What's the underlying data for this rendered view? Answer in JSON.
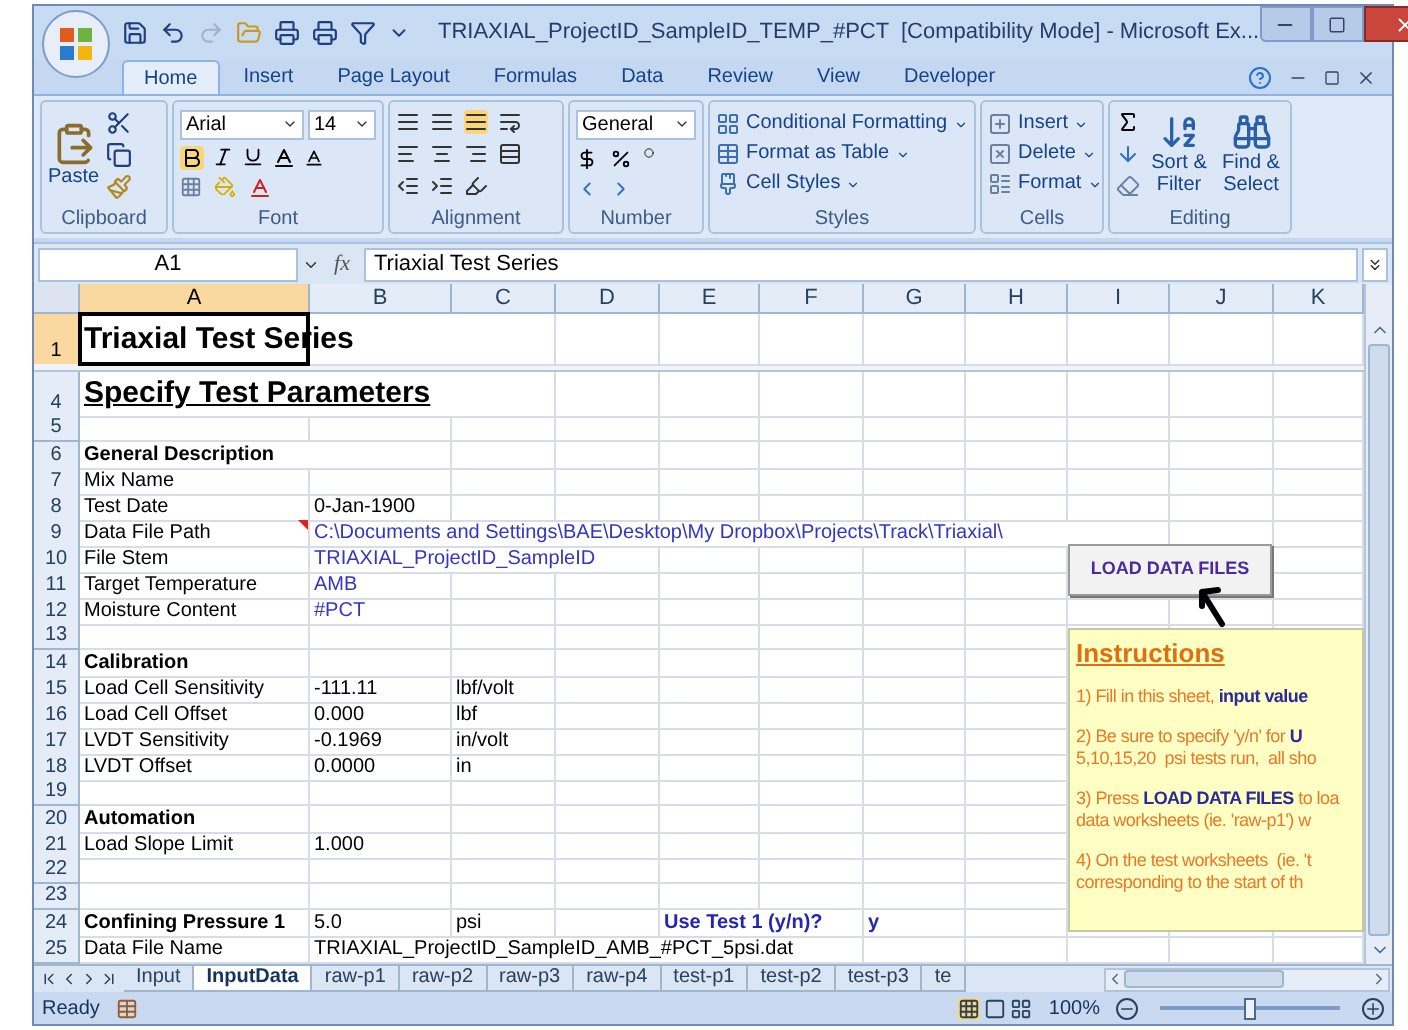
{
  "window": {
    "title": "TRIAXIAL_ProjectID_SampleID_TEMP_#PCT  [Compatibility Mode] - Microsoft Ex..."
  },
  "ribbon_tabs": [
    {
      "label": "Home",
      "selected": true
    },
    {
      "label": "Insert",
      "selected": false
    },
    {
      "label": "Page Layout",
      "selected": false
    },
    {
      "label": "Formulas",
      "selected": false
    },
    {
      "label": "Data",
      "selected": false
    },
    {
      "label": "Review",
      "selected": false
    },
    {
      "label": "View",
      "selected": false
    },
    {
      "label": "Developer",
      "selected": false
    }
  ],
  "ribbon": {
    "clipboard": {
      "paste": "Paste",
      "label": "Clipboard"
    },
    "font": {
      "name": "Arial",
      "size": "14",
      "label": "Font"
    },
    "alignment": {
      "label": "Alignment"
    },
    "number": {
      "format": "General",
      "label": "Number"
    },
    "styles": {
      "items": [
        "Conditional Formatting",
        "Format as Table",
        "Cell Styles"
      ],
      "label": "Styles"
    },
    "cells": {
      "items": [
        "Insert",
        "Delete",
        "Format"
      ],
      "label": "Cells"
    },
    "editing": {
      "items": [
        "Sort & Filter",
        "Find & Select"
      ],
      "label": "Editing"
    }
  },
  "formula_bar": {
    "name_box": "A1",
    "function_label": "fx",
    "formula": "Triaxial Test Series"
  },
  "columns": [
    {
      "label": "A",
      "selected": true
    },
    {
      "label": "B",
      "selected": false
    },
    {
      "label": "C",
      "selected": false
    },
    {
      "label": "D",
      "selected": false
    },
    {
      "label": "E",
      "selected": false
    },
    {
      "label": "F",
      "selected": false
    },
    {
      "label": "G",
      "selected": false
    },
    {
      "label": "H",
      "selected": false
    },
    {
      "label": "I",
      "selected": false
    },
    {
      "label": "J",
      "selected": false
    },
    {
      "label": "K",
      "selected": false
    }
  ],
  "rows": [
    {
      "kind": "title",
      "number": "1",
      "selected": true,
      "cells": {
        "A": {
          "kind": "title",
          "text": "Triaxial Test Series"
        }
      }
    },
    {
      "kind": "hidden"
    },
    {
      "kind": "heading",
      "number": "4",
      "selected": false,
      "cells": {
        "A": {
          "kind": "heading",
          "text": "Specify Test Parameters"
        }
      }
    },
    {
      "kind": "normal",
      "number": "5",
      "selected": false
    },
    {
      "kind": "normal",
      "number": "6",
      "selected": false,
      "cells": {
        "A": {
          "kind": "section",
          "text": "General Description"
        }
      }
    },
    {
      "kind": "normal",
      "number": "7",
      "selected": false,
      "cells": {
        "A": {
          "kind": "text",
          "text": "Mix Name"
        }
      }
    },
    {
      "kind": "normal",
      "number": "8",
      "selected": false,
      "cells": {
        "A": {
          "kind": "text",
          "text": "Test Date"
        },
        "B": {
          "kind": "text",
          "text": "0-Jan-1900"
        }
      }
    },
    {
      "kind": "normal",
      "number": "9",
      "selected": false,
      "cells": {
        "A": {
          "kind": "text",
          "text": "Data File Path",
          "comment": true
        },
        "B": {
          "kind": "link",
          "text": "C:\\Documents and Settings\\BAE\\Desktop\\My Dropbox\\Projects\\Track\\Triaxial\\"
        }
      }
    },
    {
      "kind": "normal",
      "number": "10",
      "selected": false,
      "cells": {
        "A": {
          "kind": "text",
          "text": "File Stem"
        },
        "B": {
          "kind": "link",
          "text": "TRIAXIAL_ProjectID_SampleID"
        }
      }
    },
    {
      "kind": "normal",
      "number": "11",
      "selected": false,
      "cells": {
        "A": {
          "kind": "text",
          "text": "Target Temperature"
        },
        "B": {
          "kind": "link",
          "text": "AMB"
        }
      }
    },
    {
      "kind": "normal",
      "number": "12",
      "selected": false,
      "cells": {
        "A": {
          "kind": "text",
          "text": "Moisture Content"
        },
        "B": {
          "kind": "link",
          "text": "#PCT"
        }
      }
    },
    {
      "kind": "normal",
      "number": "13",
      "selected": false
    },
    {
      "kind": "normal",
      "number": "14",
      "selected": false,
      "cells": {
        "A": {
          "kind": "section",
          "text": "Calibration"
        }
      }
    },
    {
      "kind": "normal",
      "number": "15",
      "selected": false,
      "cells": {
        "A": {
          "kind": "text",
          "text": "Load Cell Sensitivity"
        },
        "B": {
          "kind": "text",
          "text": "-111.11"
        },
        "C": {
          "kind": "text",
          "text": "lbf/volt"
        }
      }
    },
    {
      "kind": "normal",
      "number": "16",
      "selected": false,
      "cells": {
        "A": {
          "kind": "text",
          "text": "Load Cell Offset"
        },
        "B": {
          "kind": "text",
          "text": "0.000"
        },
        "C": {
          "kind": "text",
          "text": "lbf"
        }
      }
    },
    {
      "kind": "normal",
      "number": "17",
      "selected": false,
      "cells": {
        "A": {
          "kind": "text",
          "text": "LVDT Sensitivity"
        },
        "B": {
          "kind": "text",
          "text": "-0.1969"
        },
        "C": {
          "kind": "text",
          "text": "in/volt"
        }
      }
    },
    {
      "kind": "normal",
      "number": "18",
      "selected": false,
      "cells": {
        "A": {
          "kind": "text",
          "text": "LVDT Offset"
        },
        "B": {
          "kind": "text",
          "text": "0.0000"
        },
        "C": {
          "kind": "text",
          "text": "in"
        }
      }
    },
    {
      "kind": "normal",
      "number": "19",
      "selected": false
    },
    {
      "kind": "normal",
      "number": "20",
      "selected": false,
      "cells": {
        "A": {
          "kind": "section",
          "text": "Automation"
        }
      }
    },
    {
      "kind": "normal",
      "number": "21",
      "selected": false,
      "cells": {
        "A": {
          "kind": "text",
          "text": "Load Slope Limit"
        },
        "B": {
          "kind": "text",
          "text": "1.000"
        }
      }
    },
    {
      "kind": "normal",
      "number": "22",
      "selected": false
    },
    {
      "kind": "normal",
      "number": "23",
      "selected": false
    },
    {
      "kind": "normal",
      "number": "24",
      "selected": false,
      "cells": {
        "A": {
          "kind": "section",
          "text": "Confining Pressure 1"
        },
        "B": {
          "kind": "text",
          "text": "5.0"
        },
        "C": {
          "kind": "text",
          "text": "psi"
        },
        "E": {
          "kind": "prompt",
          "text": "Use Test 1 (y/n)?"
        },
        "G": {
          "kind": "prompt",
          "text": "y"
        }
      }
    },
    {
      "kind": "normal",
      "number": "25",
      "selected": false,
      "cells": {
        "A": {
          "kind": "text",
          "text": "Data File Name"
        },
        "B": {
          "kind": "text",
          "text": "TRIAXIAL_ProjectID_SampleID_AMB_#PCT_5psi.dat"
        }
      }
    }
  ],
  "load_button": "LOAD DATA FILES",
  "instructions": {
    "title": "Instructions",
    "paragraphs": [
      [
        "1) Fill in this sheet, **input value**"
      ],
      [
        "2) Be sure to specify 'y/n' for **U**",
        "5,10,15,20  psi tests run,  all sho"
      ],
      [
        "3) Press **LOAD DATA FILES** to loa",
        "data worksheets (ie. 'raw-p1') w"
      ],
      [
        "4) On the test worksheets  (ie. 't",
        "corresponding to the start of th"
      ]
    ]
  },
  "sheet_tabs": [
    {
      "label": "Input",
      "selected": false
    },
    {
      "label": "InputData",
      "selected": true
    },
    {
      "label": "raw-p1",
      "selected": false
    },
    {
      "label": "raw-p2",
      "selected": false
    },
    {
      "label": "raw-p3",
      "selected": false
    },
    {
      "label": "raw-p4",
      "selected": false
    },
    {
      "label": "test-p1",
      "selected": false
    },
    {
      "label": "test-p2",
      "selected": false
    },
    {
      "label": "test-p3",
      "selected": false
    },
    {
      "label": "te",
      "selected": false
    }
  ],
  "status_bar": {
    "status": "Ready",
    "zoom": "100%",
    "level": 0.5
  }
}
